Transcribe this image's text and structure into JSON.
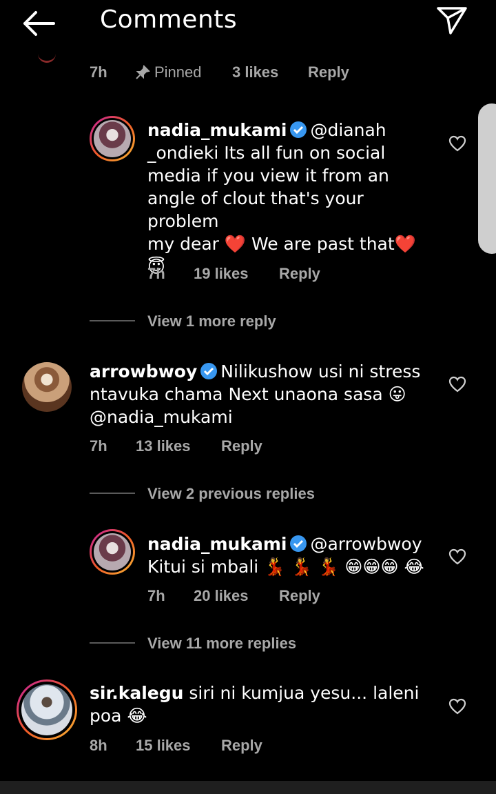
{
  "header": {
    "title": "Comments"
  },
  "pinned_row": {
    "time": "7h",
    "pinned_label": "Pinned",
    "likes": "3 likes",
    "reply": "Reply"
  },
  "comments": [
    {
      "user": "nadia_mukami",
      "text": "@dianah _ondieki Its all fun on social media if you view it from an angle of clout that's your problem my dear ❤️ We are past that❤️ 😇",
      "line1": "@dianah",
      "line2": "_ondieki Its all fun on social",
      "line3": "media if you view it from an",
      "line4": "angle of clout that's your problem",
      "line5": "my dear ❤️ We are past that❤️",
      "line6": "😇",
      "time": "7h",
      "likes": "19 likes",
      "reply": "Reply"
    },
    {
      "user": "arrowbwoy",
      "line1": "Nilikushow usi ni stress",
      "line2": "ntavuka chama Next unaona sasa 😛",
      "line3": "@nadia_mukami",
      "time": "7h",
      "likes": "13 likes",
      "reply": "Reply"
    },
    {
      "user": "nadia_mukami",
      "line1": "@arrowbwoy",
      "line2": "Kitui si mbali 💃 💃 💃 😁😁😁 😂",
      "time": "7h",
      "likes": "20 likes",
      "reply": "Reply"
    },
    {
      "user": "sir.kalegu",
      "line1": "siri ni kumjua yesu... laleni",
      "line2": "poa 😂",
      "time": "8h",
      "likes": "15 likes",
      "reply": "Reply"
    }
  ],
  "view_more_1": "View 1 more reply",
  "view_prev": "View 2 previous replies",
  "view_more_2": "View 11 more replies",
  "colors": {
    "background": "#000000",
    "meta_gray": "#a8a8a8",
    "verified_blue": "#3897f0",
    "heart_red": "#e0245e"
  },
  "icons": [
    "back-arrow-icon",
    "send-icon",
    "pin-icon",
    "verified-badge-icon",
    "heart-outline-icon"
  ]
}
